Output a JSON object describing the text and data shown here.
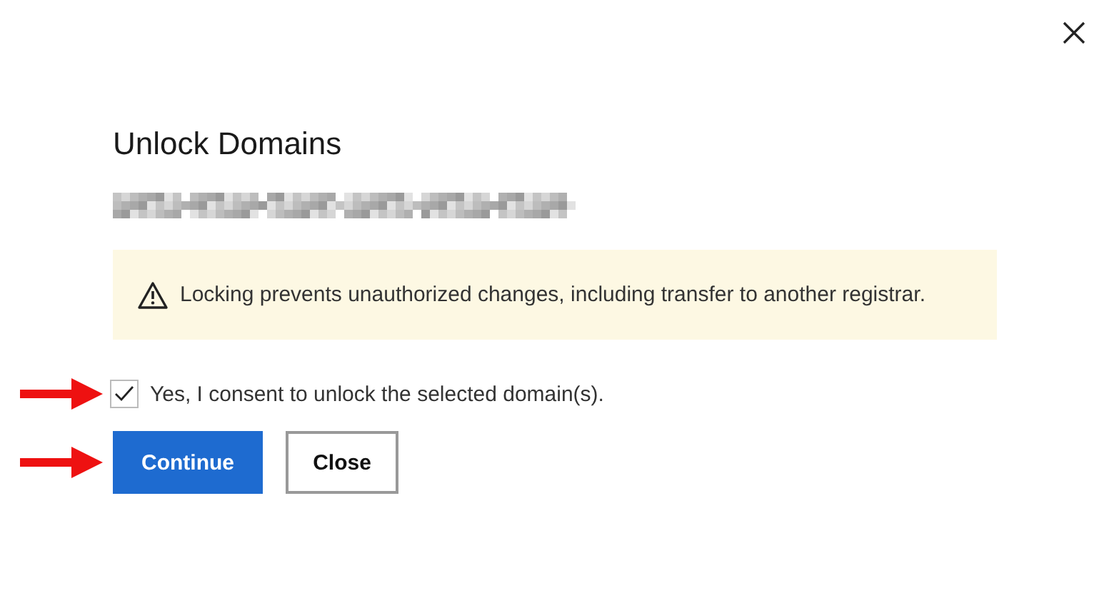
{
  "dialog": {
    "title": "Unlock Domains",
    "domain_pixelated": true,
    "notice": {
      "kind": "warning",
      "text": "Locking prevents unauthorized changes, including transfer to another registrar."
    },
    "consent": {
      "label": "Yes, I consent to unlock the selected domain(s).",
      "checked": true,
      "pointer_arrow": true
    },
    "buttons": [
      {
        "label": "Continue",
        "kind": "primary",
        "pointer_arrow": true
      },
      {
        "label": "Close",
        "kind": "secondary",
        "pointer_arrow": false
      }
    ]
  }
}
